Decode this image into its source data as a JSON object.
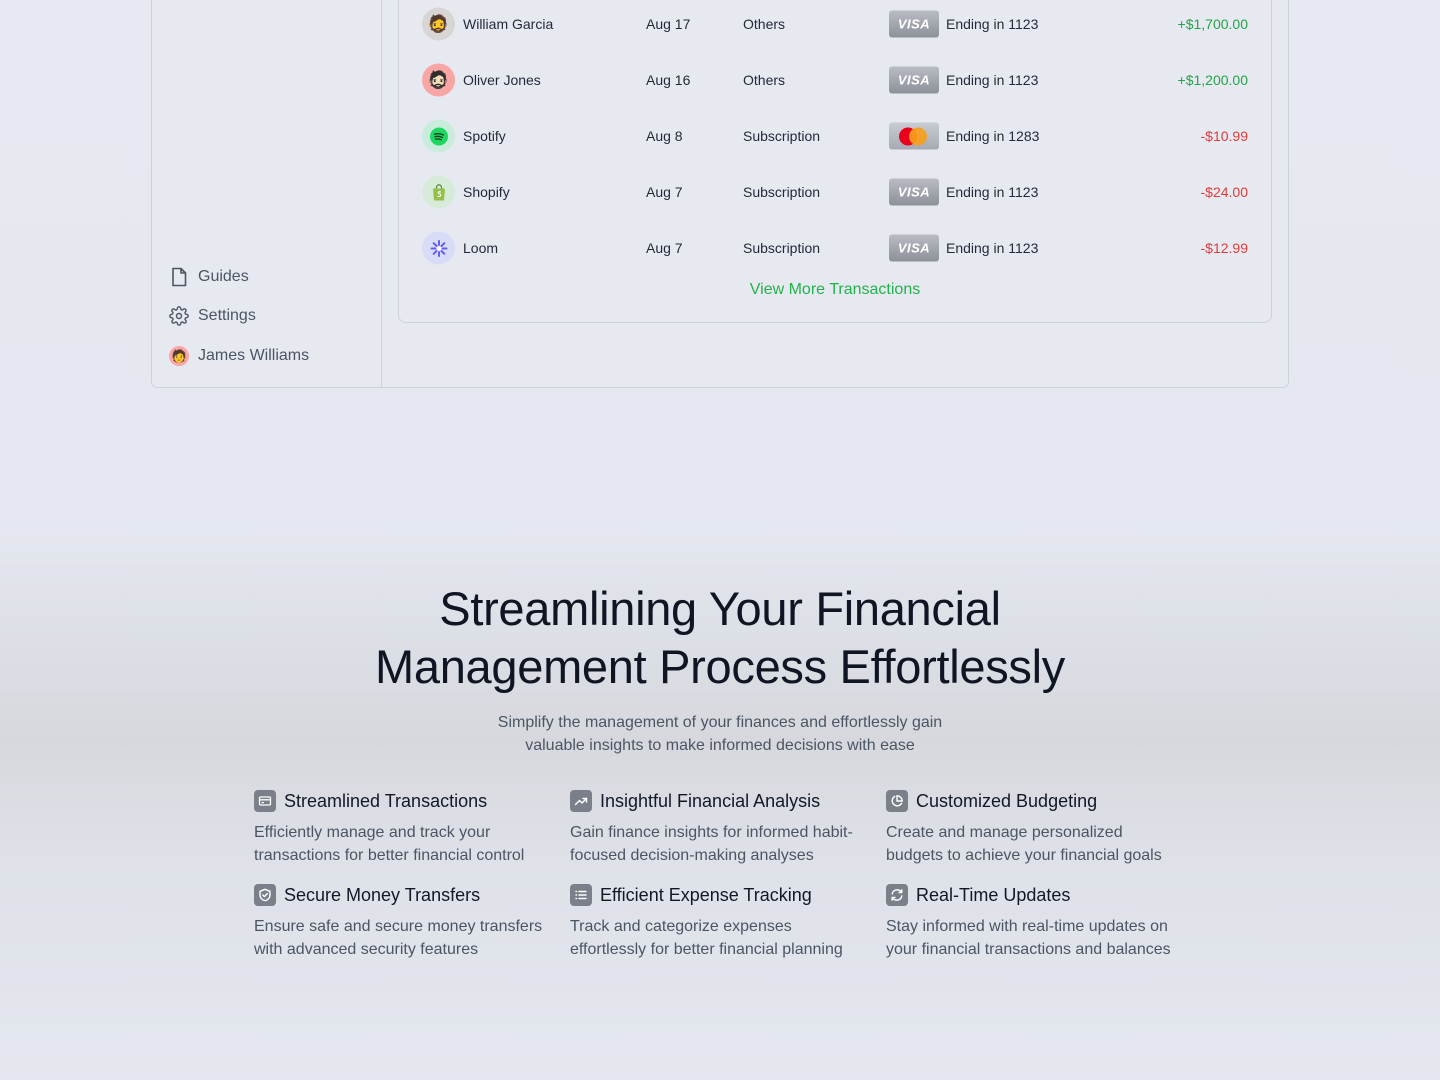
{
  "sidebar": {
    "items": [
      {
        "label": "Guides",
        "icon": "document-icon"
      },
      {
        "label": "Settings",
        "icon": "gear-icon"
      }
    ],
    "user": {
      "name": "James Williams",
      "avatar": "🧑"
    }
  },
  "transactions": {
    "rows": [
      {
        "name": "William Garcia",
        "avatar": "🧔",
        "avatar_bg": "#d8d6d4",
        "date": "Aug 17",
        "category": "Others",
        "card": "VISA",
        "ending": "Ending in 1123",
        "amount": "+$1,700.00",
        "sign": "pos"
      },
      {
        "name": "Oliver Jones",
        "avatar": "🧔🏻",
        "avatar_bg": "#f8a5a5",
        "date": "Aug 16",
        "category": "Others",
        "card": "VISA",
        "ending": "Ending in 1123",
        "amount": "+$1,200.00",
        "sign": "pos"
      },
      {
        "name": "Spotify",
        "avatar": "◉",
        "avatar_bg": "#c9ecdc",
        "date": "Aug 8",
        "category": "Subscription",
        "card": "MASTERCARD",
        "ending": "Ending in 1283",
        "amount": "-$10.99",
        "sign": "neg"
      },
      {
        "name": "Shopify",
        "avatar": "🛍",
        "avatar_bg": "#d6ecd9",
        "date": "Aug 7",
        "category": "Subscription",
        "card": "VISA",
        "ending": "Ending in 1123",
        "amount": "-$24.00",
        "sign": "neg"
      },
      {
        "name": "Loom",
        "avatar": "✺",
        "avatar_bg": "#d9dcf7",
        "date": "Aug 7",
        "category": "Subscription",
        "card": "VISA",
        "ending": "Ending in 1123",
        "amount": "-$12.99",
        "sign": "neg"
      }
    ],
    "view_more": "View More Transactions"
  },
  "hero": {
    "title_line1": "Streamlining Your Financial",
    "title_line2": "Management Process Effortlessly",
    "subtitle_line1": "Simplify the management of your finances and effortlessly gain",
    "subtitle_line2": "valuable insights to make informed decisions with ease"
  },
  "features": [
    {
      "title": "Streamlined Transactions",
      "icon": "credit-card-icon",
      "desc_line1": "Efficiently manage and track your",
      "desc_line2": "transactions for better financial control"
    },
    {
      "title": "Insightful Financial Analysis",
      "icon": "trending-up-icon",
      "desc_line1": "Gain finance insights for informed habit-",
      "desc_line2": "focused decision-making analyses"
    },
    {
      "title": "Customized Budgeting",
      "icon": "pie-chart-icon",
      "desc_line1": "Create and manage personalized",
      "desc_line2": "budgets to achieve your financial goals"
    },
    {
      "title": "Secure Money Transfers",
      "icon": "shield-check-icon",
      "desc_line1": "Ensure safe and secure money transfers",
      "desc_line2": "with advanced security features"
    },
    {
      "title": "Efficient Expense Tracking",
      "icon": "list-icon",
      "desc_line1": "Track and categorize expenses",
      "desc_line2": "effortlessly for better financial planning"
    },
    {
      "title": "Real-Time Updates",
      "icon": "refresh-icon",
      "desc_line1": "Stay informed with real-time updates on",
      "desc_line2": "your financial transactions and balances"
    }
  ],
  "colors": {
    "positive": "#22a447",
    "negative": "#e23b3b",
    "link": "#22b24c"
  }
}
